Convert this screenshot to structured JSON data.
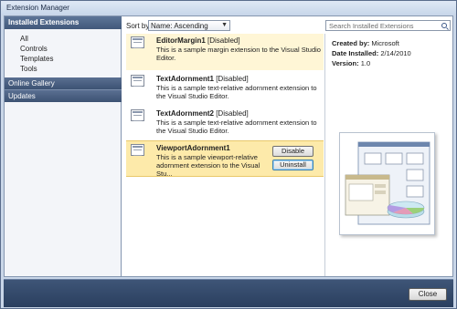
{
  "window": {
    "title": "Extension Manager"
  },
  "sidebar": {
    "header": "Installed Extensions",
    "items": [
      {
        "label": "All"
      },
      {
        "label": "Controls"
      },
      {
        "label": "Templates"
      },
      {
        "label": "Tools"
      }
    ],
    "online_gallery": "Online Gallery",
    "updates": "Updates"
  },
  "sort": {
    "label": "Sort by:",
    "value": "Name: Ascending"
  },
  "search": {
    "placeholder": "Search Installed Extensions"
  },
  "extensions": [
    {
      "name": "EditorMargin1",
      "status": "[Disabled]",
      "description": "This is a sample margin extension to the Visual Studio Editor."
    },
    {
      "name": "TextAdornment1",
      "status": "[Disabled]",
      "description": "This is a sample text-relative adornment extension to the Visual Studio Editor."
    },
    {
      "name": "TextAdornment2",
      "status": "[Disabled]",
      "description": "This is a sample text-relative adornment extension to the Visual Studio Editor."
    },
    {
      "name": "ViewportAdornment1",
      "status": "",
      "description": "This is a sample viewport-relative adornment extension to the Visual Stu..."
    }
  ],
  "actions": {
    "disable": "Disable",
    "uninstall": "Uninstall"
  },
  "details": {
    "created_by_label": "Created by:",
    "created_by": "Microsoft",
    "date_label": "Date Installed:",
    "date": "2/14/2010",
    "version_label": "Version:",
    "version": "1.0"
  },
  "footer": {
    "close": "Close"
  },
  "colors": {
    "nav_header": "#41587a",
    "selected_item": "#fdeaaa",
    "bottom_bar": "#2a3f5f"
  },
  "icons": [
    "extension-icon",
    "search-icon",
    "chevron-down-icon",
    "preview-image"
  ]
}
